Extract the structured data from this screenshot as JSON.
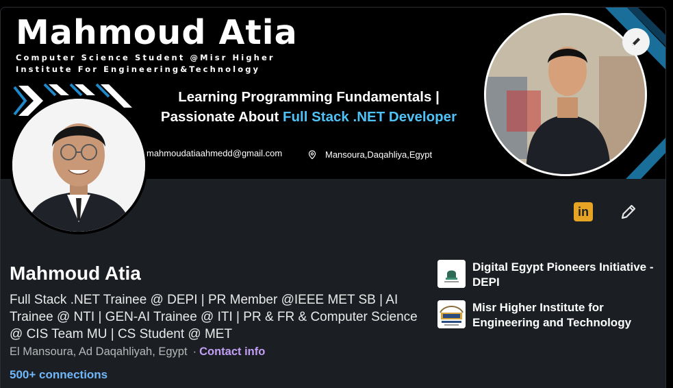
{
  "banner": {
    "name": "Mahmoud Atia",
    "subtitle_line1": "Computer Science Student @Misr Higher",
    "subtitle_line2": "Institute For Engineering&Technology",
    "tagline_line1": "Learning Programming Fundamentals |",
    "tagline_line2_prefix": "Passionate About ",
    "tagline_line2_accent": "Full Stack .NET Developer",
    "email": "mahmoudatiaahmedd@gmail.com",
    "location": "Mansoura,Daqahliya,Egypt"
  },
  "profile": {
    "name": "Mahmoud Atia",
    "headline": "Full Stack .NET Trainee @ DEPI | PR Member @IEEE MET SB | AI Trainee @ NTI | GEN-AI Trainee @ ITI | PR & FR & Computer Science @ CIS Team MU | CS Student @ MET",
    "location": "El Mansoura, Ad Daqahliyah, Egypt",
    "separator": "·",
    "contact_info": "Contact info",
    "connections": "500+ connections"
  },
  "icons": {
    "linkedin_label": "in"
  },
  "organizations": [
    {
      "name": "Digital Egypt Pioneers Initiative - DEPI"
    },
    {
      "name": "Misr Higher Institute for Engineering and Technology"
    }
  ],
  "colors": {
    "background": "#1b1f23",
    "accent_link": "#71b7fb",
    "contact_link": "#c39ef5",
    "tagline_accent": "#4fc3f7",
    "linkedin_badge": "#e6a324"
  }
}
